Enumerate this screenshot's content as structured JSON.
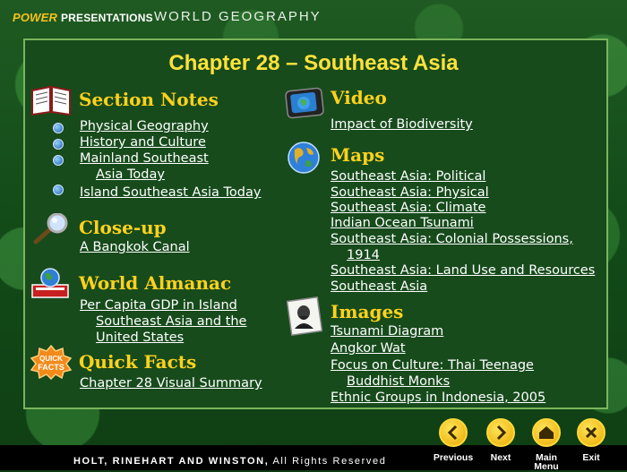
{
  "header": {
    "brand_power": "POWER",
    "brand_presentations": "PRESENTATIONS",
    "series": "WORLD GEOGRAPHY"
  },
  "title": "Chapter 28 – Southeast Asia",
  "sections": {
    "section_notes": {
      "heading": "Section Notes",
      "links": [
        "Physical Geography",
        "History and Culture",
        "Mainland Southeast",
        "Asia Today",
        "Island Southeast Asia Today"
      ]
    },
    "close_up": {
      "heading": "Close-up",
      "links": [
        "A Bangkok Canal"
      ]
    },
    "world_almanac": {
      "heading": "World Almanac",
      "links": [
        "Per Capita GDP in Island",
        "Southeast Asia and the",
        "United States"
      ]
    },
    "quick_facts": {
      "heading": "Quick Facts",
      "links": [
        "Chapter 28 Visual Summary"
      ]
    },
    "video": {
      "heading": "Video",
      "links": [
        "Impact of Biodiversity"
      ]
    },
    "maps": {
      "heading": "Maps",
      "links": [
        "Southeast Asia: Political",
        "Southeast Asia: Physical",
        "Southeast Asia: Climate",
        "Indian Ocean Tsunami",
        "Southeast Asia: Colonial Possessions,",
        "1914",
        "Southeast Asia: Land Use and Resources",
        "Southeast Asia"
      ]
    },
    "images": {
      "heading": "Images",
      "links": [
        "Tsunami Diagram",
        "Angkor Wat",
        "Focus on Culture: Thai Teenage",
        "Buddhist Monks",
        "Ethnic Groups in Indonesia, 2005"
      ]
    }
  },
  "icons": {
    "quick_facts_line1": "QUICK",
    "quick_facts_line2": "FACTS"
  },
  "footer": {
    "publisher": "HOLT, RINEHART AND WINSTON,",
    "rights": " All Rights Reserved",
    "nav": {
      "previous": "Previous",
      "next": "Next",
      "main_line1": "Main",
      "main_line2": "Menu",
      "exit": "Exit"
    }
  },
  "colors": {
    "heading": "#ffd21c",
    "title": "#ffe23a",
    "panel": "#174b1c",
    "button": "#f2c21a"
  }
}
